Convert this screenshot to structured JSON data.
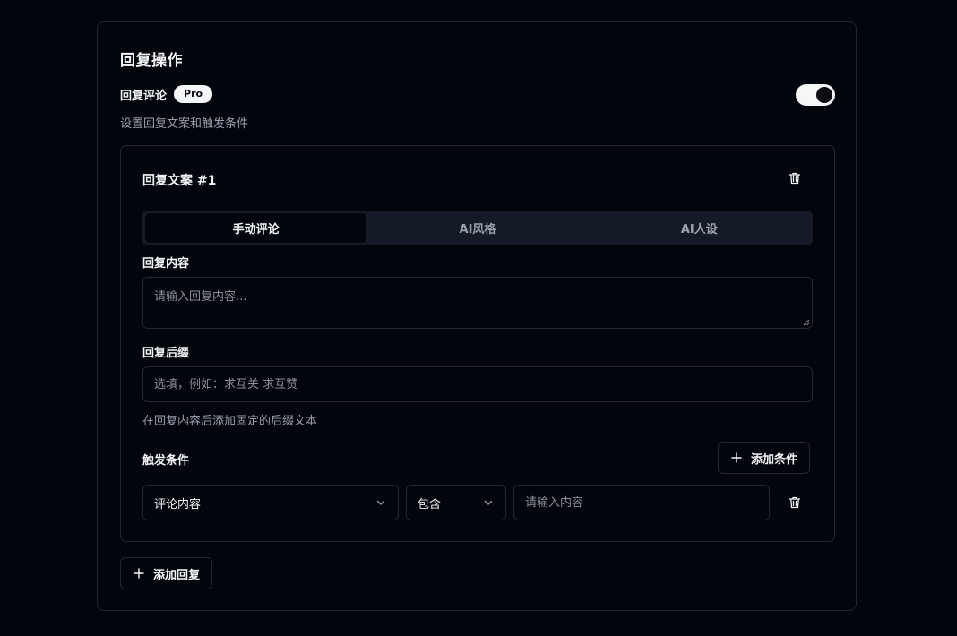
{
  "section": {
    "title": "回复操作",
    "feature_label": "回复评论",
    "badge": "Pro",
    "description": "设置回复文案和触发条件",
    "toggle_on": true
  },
  "reply": {
    "title": "回复文案 #1",
    "tabs": [
      {
        "label": "手动评论",
        "active": true
      },
      {
        "label": "AI风格",
        "active": false
      },
      {
        "label": "AI人设",
        "active": false
      }
    ],
    "content_label": "回复内容",
    "content_placeholder": "请输入回复内容...",
    "suffix_label": "回复后缀",
    "suffix_placeholder": "选填，例如：求互关 求互赞",
    "suffix_hint": "在回复内容后添加固定的后缀文本",
    "trigger_label": "触发条件",
    "add_condition_label": "添加条件",
    "condition": {
      "field": "评论内容",
      "operator": "包含",
      "value_placeholder": "请输入内容"
    }
  },
  "add_reply_label": "添加回复",
  "icons": {
    "delete": "trash-icon",
    "add": "plus-icon",
    "dropdown": "chevron-down-icon"
  },
  "colors": {
    "background": "#03050c",
    "border": "#232733",
    "tab_bg": "#151a27",
    "text": "#f5f6f8",
    "muted": "#9aa0ad"
  }
}
